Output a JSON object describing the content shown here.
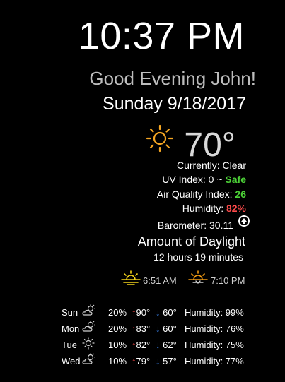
{
  "clock": {
    "time": "10:37 PM"
  },
  "greeting": {
    "text": "Good Evening John!"
  },
  "date": {
    "text": "Sunday 9/18/2017"
  },
  "current": {
    "icon": "sun-icon",
    "temperature": "70°",
    "currently_label": "Currently: ",
    "currently_value": "Clear",
    "uv_label": "UV Index: 0 ~ ",
    "uv_value": "Safe",
    "aqi_label": "Air Quality Index: ",
    "aqi_value": "26",
    "humidity_label": "Humidity: ",
    "humidity_value": "82%",
    "barometer_label": "Barometer: ",
    "barometer_value": "30.11",
    "barometer_icon": "arrow-up-circle-icon"
  },
  "daylight": {
    "title": "Amount of Daylight",
    "duration": "12 hours 19 minutes",
    "sunrise": "6:51 AM",
    "sunset": "7:10 PM"
  },
  "forecast": [
    {
      "day": "Sun",
      "icon": "partly-cloudy-icon",
      "pop": "20%",
      "high": "90°",
      "low": "60°",
      "humidity": "Humidity: 99%"
    },
    {
      "day": "Mon",
      "icon": "partly-cloudy-icon",
      "pop": "20%",
      "high": "83°",
      "low": "60°",
      "humidity": "Humidity: 76%"
    },
    {
      "day": "Tue",
      "icon": "sun-icon",
      "pop": "10%",
      "high": "82°",
      "low": "62°",
      "humidity": "Humidity: 75%"
    },
    {
      "day": "Wed",
      "icon": "partly-cloudy-icon",
      "pop": "10%",
      "high": "79°",
      "low": "57°",
      "humidity": "Humidity: 77%"
    }
  ],
  "colors": {
    "background": "#000000",
    "safe": "#4cd137",
    "aqi": "#4cd137",
    "humidity_alert": "#ff4b4b",
    "sun": "#f5a623",
    "sunrise": "#f2d21a",
    "sunset": "#f39c12",
    "high_arrow": "#ff4b4b",
    "low_arrow": "#3f8cff"
  },
  "glyphs": {
    "up_arrow": "↑",
    "down_arrow": "↓"
  }
}
